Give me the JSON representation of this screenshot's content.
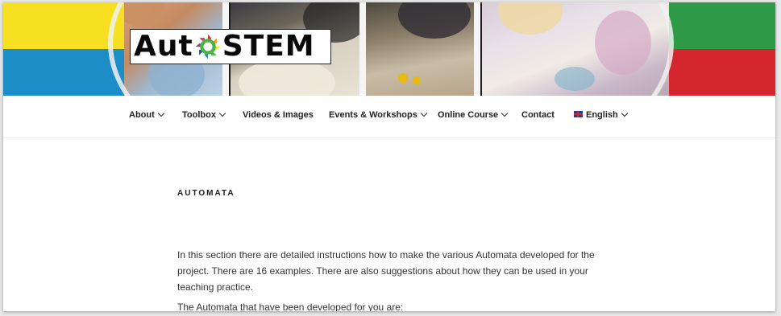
{
  "site": {
    "logo_text_left": "Aut",
    "logo_text_right": "STEM",
    "colors": {
      "yellow": "#f6e021",
      "blue": "#1d8dc8",
      "green": "#2e9a48",
      "red": "#d3272d"
    }
  },
  "nav": {
    "items": [
      {
        "label": "About",
        "has_dropdown": true
      },
      {
        "label": "Toolbox",
        "has_dropdown": true
      },
      {
        "label": "Videos & Images",
        "has_dropdown": false
      },
      {
        "label": "Events & Workshops",
        "has_dropdown": true
      },
      {
        "label": "Online Course",
        "has_dropdown": true
      },
      {
        "label": "Contact",
        "has_dropdown": false
      },
      {
        "label": "English",
        "has_dropdown": true,
        "icon": "uk-flag-icon"
      }
    ]
  },
  "main": {
    "title": "AUTOMATA",
    "paragraph": "In this section there are detailed instructions how to make the various Automata developed for the project. There are 16 examples. There are also suggestions about how they can be used in your teaching practice.",
    "list_intro": "The Automata that have been developed for you are:"
  }
}
